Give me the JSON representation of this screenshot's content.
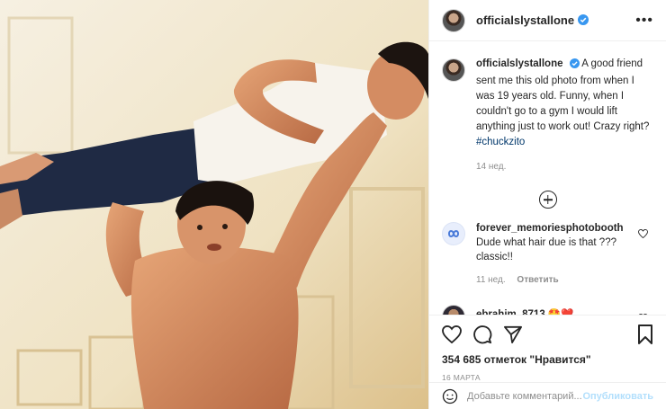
{
  "post": {
    "author": "officialslystallone",
    "verified": true,
    "more_icon": "more-dots-icon",
    "caption": {
      "text": "A good friend sent me this old photo from when I was 19 years old. Funny, when I couldn't go to a gym I would lift anything just to work out! Crazy right?",
      "hashtag": "#chuckzito",
      "age": "14 нед."
    },
    "comments": [
      {
        "username": "forever_memoriesphotobooth",
        "text": "Dude what hair due is that ??? classic!!",
        "age": "11 нед.",
        "reply_label": "Ответить"
      },
      {
        "username": "ebrahim_8713",
        "text": "🤩❤️"
      }
    ],
    "likes": "354 685 отметок \"Нравится\"",
    "date": "16 МАРТА",
    "add_comment_placeholder": "Добавьте комментарий...",
    "publish_label": "Опубликовать"
  },
  "colors": {
    "verified": "#3897f0",
    "link": "#00376b",
    "muted": "#8e8e8e",
    "publish_disabled": "#b2dffc"
  }
}
